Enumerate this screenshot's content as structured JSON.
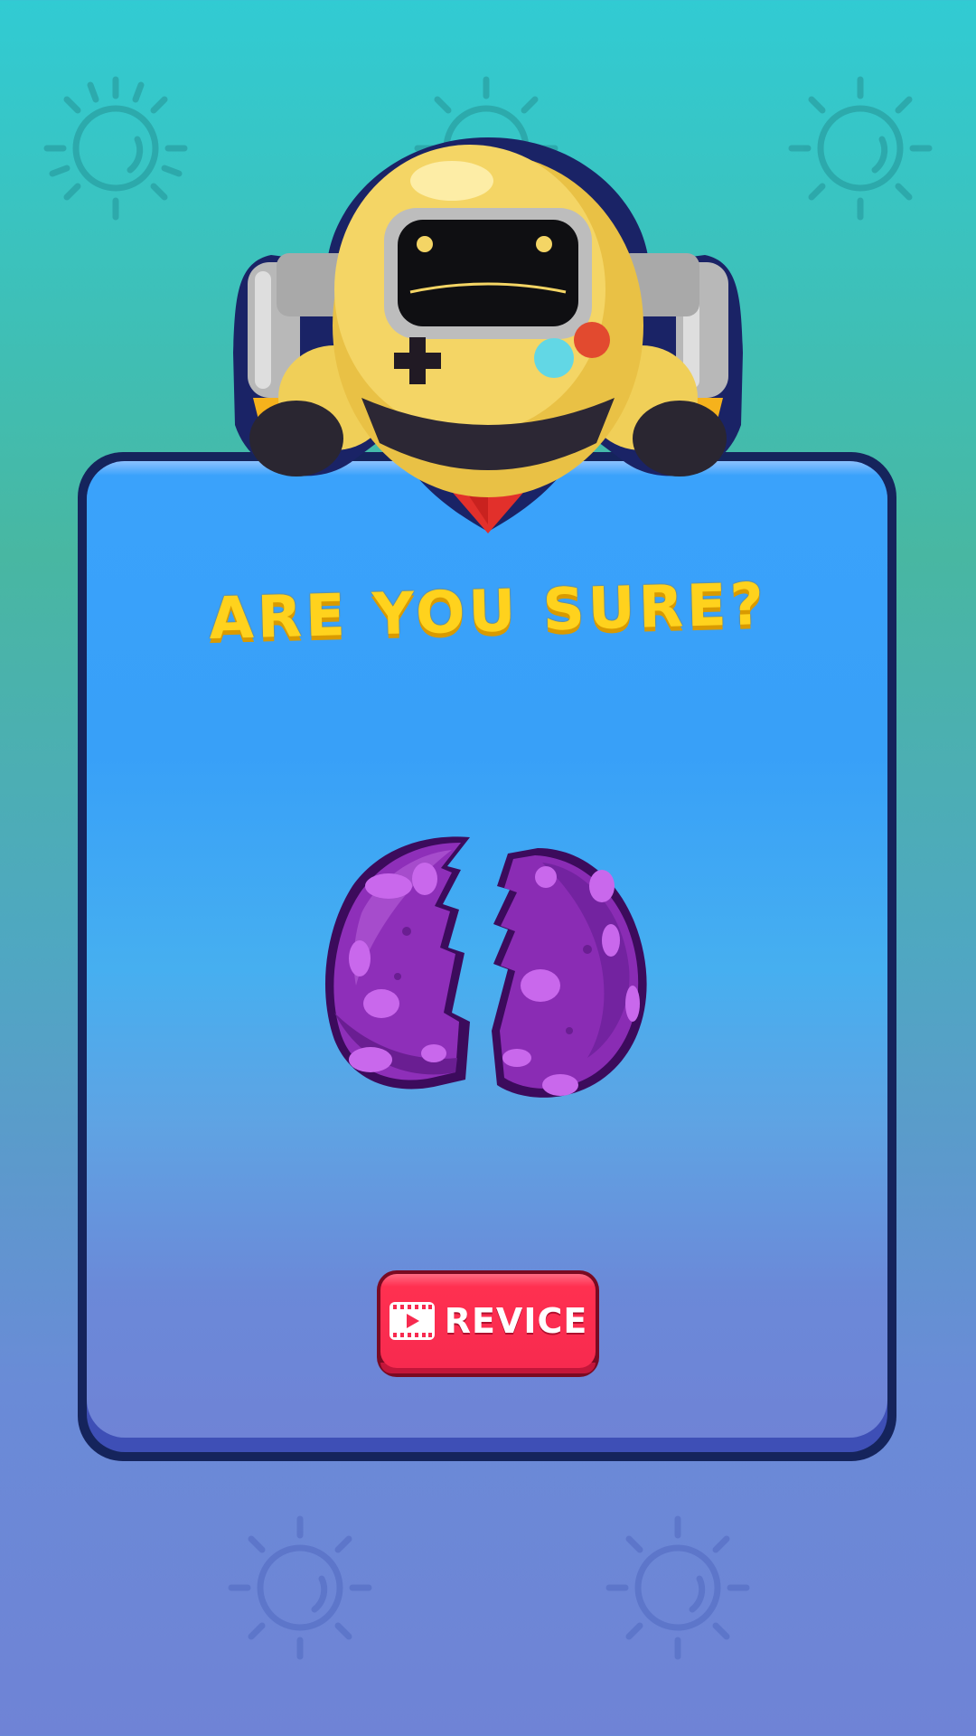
{
  "dialog": {
    "title": "ARE YOU SURE?",
    "revive_button": {
      "label": "REVICE",
      "icon": "video-ad-icon",
      "color": "#ff3050"
    }
  },
  "art": {
    "mascot": "robot-mascot",
    "item": "cracked-purple-egg"
  },
  "background": {
    "pattern_icon": "sun-icon",
    "colors": [
      "#31cbd3",
      "#48b7a2",
      "#6f83d6"
    ]
  },
  "colors": {
    "panel": "#38a0f8",
    "panel_border": "#15245c",
    "title": "#ffd21d"
  }
}
